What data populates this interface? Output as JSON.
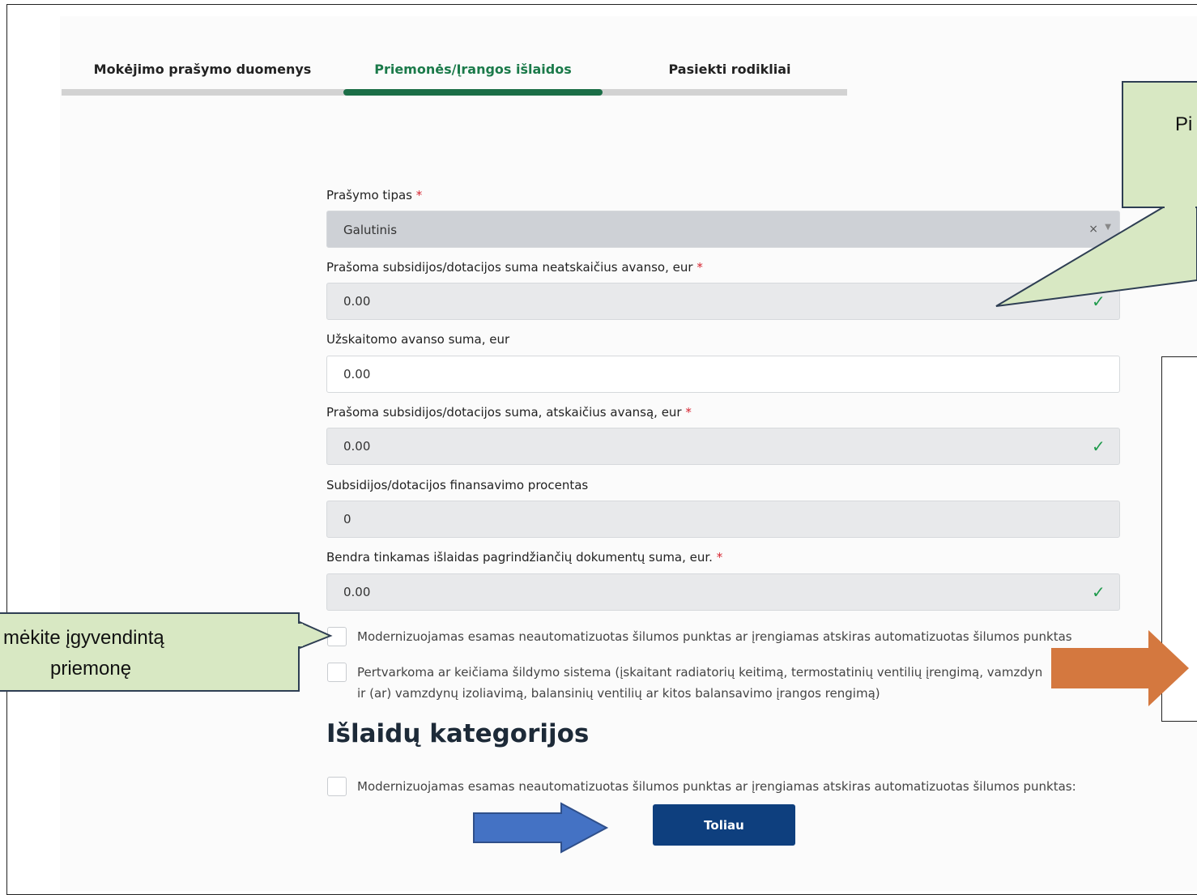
{
  "tabs": [
    {
      "label": "Mokėjimo prašymo duomenys",
      "active": false
    },
    {
      "label": "Priemonės/Įrangos išlaidos",
      "active": true
    },
    {
      "label": "Pasiekti rodikliai",
      "active": false
    }
  ],
  "form": {
    "request_type": {
      "label": "Prašymo tipas",
      "required_mark": "*",
      "value": "Galutinis",
      "clear": "×",
      "caret": "▼"
    },
    "subsidy_without_advance": {
      "label": "Prašoma subsidijos/dotacijos suma neatskaičius avanso, eur",
      "required_mark": "*",
      "value": "0.00"
    },
    "advance_offset": {
      "label": "Užskaitomo avanso suma, eur",
      "value": "0.00"
    },
    "subsidy_with_advance": {
      "label": "Prašoma subsidijos/dotacijos suma, atskaičius avansą, eur",
      "required_mark": "*",
      "value": "0.00"
    },
    "financing_percent": {
      "label": "Subsidijos/dotacijos finansavimo procentas",
      "value": "0"
    },
    "total_documents": {
      "label": "Bendra tinkamas išlaidas pagrindžiančių dokumentų suma, eur.",
      "required_mark": "*",
      "value": "0.00"
    },
    "valid_icon": "check-icon"
  },
  "measures": [
    {
      "label": "Modernizuojamas esamas neautomatizuotas šilumos punktas ar įrengiamas atskiras automatizuotas šilumos punktas",
      "checked": false
    },
    {
      "label_line1": "Pertvarkoma ar keičiama šildymo sistema (įskaitant radiatorių keitimą, termostatinių ventilių įrengimą, vamzdyn",
      "label_line2": "ir (ar) vamzdynų izoliavimą, balansinių ventilių ar kitos balansavimo įrangos rengimą)",
      "checked": false
    }
  ],
  "expense_categories": {
    "title": "Išlaidų kategorijos",
    "items": [
      {
        "label": "Modernizuojamas esamas neautomatizuotas šilumos punktas ar įrengiamas atskiras automatizuotas šilumos punktas:",
        "checked": false
      }
    ]
  },
  "next_button": "Toliau",
  "annotations": {
    "top_callout_text": "Pi",
    "left_callout_line1": "mėkite įgyvendintą",
    "left_callout_line2": "priemonę",
    "callout_color": "#d8e8c3",
    "orange_arrow_color": "#d4783f",
    "blue_arrow_color": "#4472c4"
  }
}
